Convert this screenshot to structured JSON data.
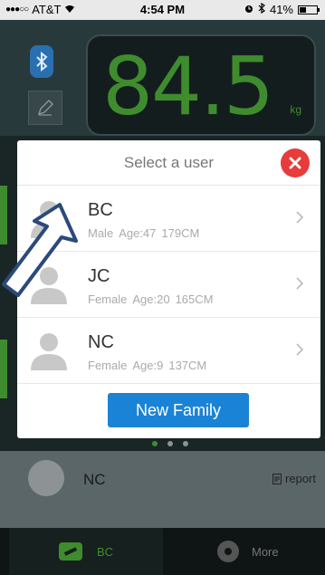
{
  "status_bar": {
    "carrier": "AT&T",
    "time": "4:54 PM",
    "battery": "41%",
    "battery_level": 0.41
  },
  "scale": {
    "value": "84.5",
    "unit": "kg"
  },
  "modal": {
    "title": "Select a user",
    "users": [
      {
        "name": "BC",
        "gender": "Male",
        "age": "Age:47",
        "height": "179CM"
      },
      {
        "name": "JC",
        "gender": "Female",
        "age": "Age:20",
        "height": "165CM"
      },
      {
        "name": "NC",
        "gender": "Female",
        "age": "Age:9",
        "height": "137CM"
      }
    ],
    "new_family_label": "New Family"
  },
  "background_row": {
    "name": "NC",
    "report_label": "report"
  },
  "tabbar": {
    "active_label": "BC",
    "more_label": "More"
  },
  "colors": {
    "accent_green": "#3f8c2e",
    "close_red": "#e83b3b",
    "button_blue": "#1a83d6"
  }
}
